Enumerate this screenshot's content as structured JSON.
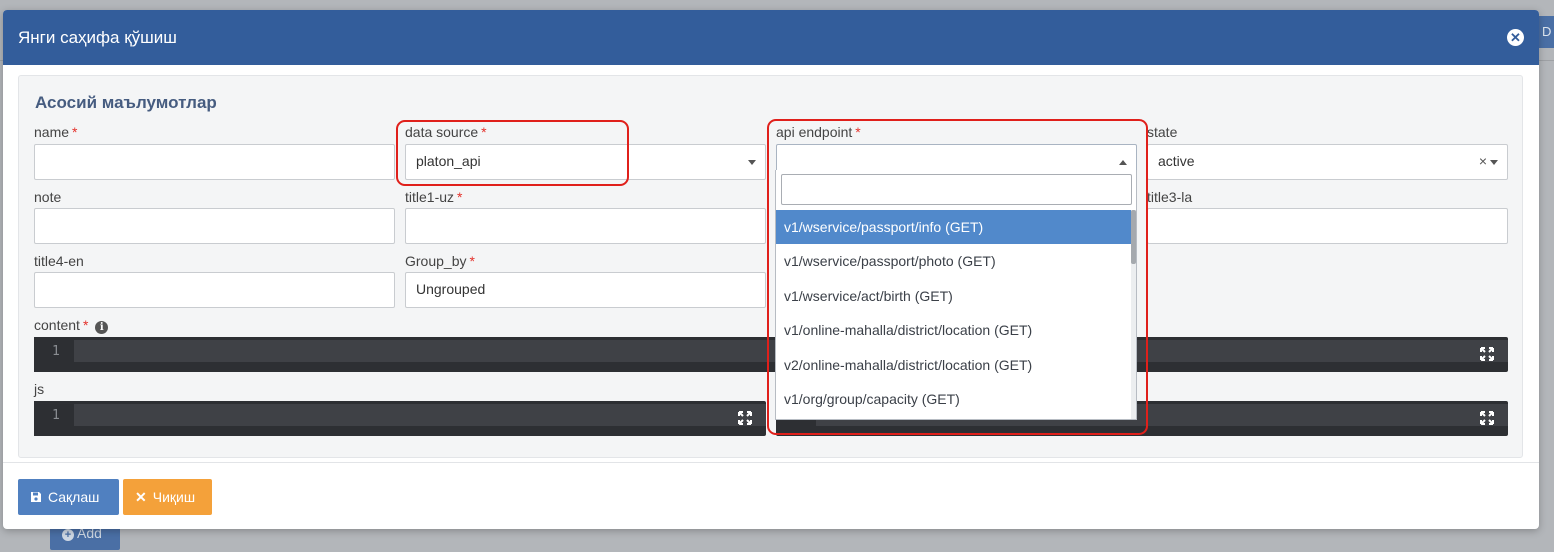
{
  "background": {
    "right_button_text": "D",
    "add_button_label": "Add"
  },
  "modal": {
    "title": "Янги саҳифа қўшиш",
    "close_icon": "close-circle-icon",
    "section_title": "Асосий маълумотлар"
  },
  "fields": {
    "name": {
      "label": "name",
      "required": "*",
      "value": ""
    },
    "data_source": {
      "label": "data source",
      "required": "*",
      "value": "platon_api"
    },
    "api_endpoint": {
      "label": "api endpoint",
      "required": "*",
      "value": ""
    },
    "state": {
      "label": "state",
      "value": "active",
      "clear": "×"
    },
    "note": {
      "label": "note",
      "value": ""
    },
    "title1_uz": {
      "label": "title1-uz",
      "required": "*",
      "value": ""
    },
    "title3_la": {
      "label": "title3-la",
      "value": ""
    },
    "title4_en": {
      "label": "title4-en",
      "value": ""
    },
    "group_by": {
      "label": "Group_by",
      "required": "*",
      "value": "Ungrouped"
    },
    "content": {
      "label": "content",
      "required": "*",
      "line_number": "1"
    },
    "js": {
      "label": "js",
      "line_number": "1"
    }
  },
  "dropdown": {
    "search_value": "",
    "options": [
      "v1/wservice/passport/info (GET)",
      "v1/wservice/passport/photo (GET)",
      "v1/wservice/act/birth (GET)",
      "v1/online-mahalla/district/location (GET)",
      "v2/online-mahalla/district/location (GET)",
      "v1/org/group/capacity (GET)"
    ],
    "highlighted_index": 0
  },
  "footer": {
    "save_label": "Сақлаш",
    "exit_label": "Чиқиш"
  },
  "colors": {
    "header": "#335d9b",
    "save_button": "#5080c0",
    "exit_button": "#f4a13a",
    "highlight": "#5189cb",
    "annotation_red": "#e0201b"
  }
}
